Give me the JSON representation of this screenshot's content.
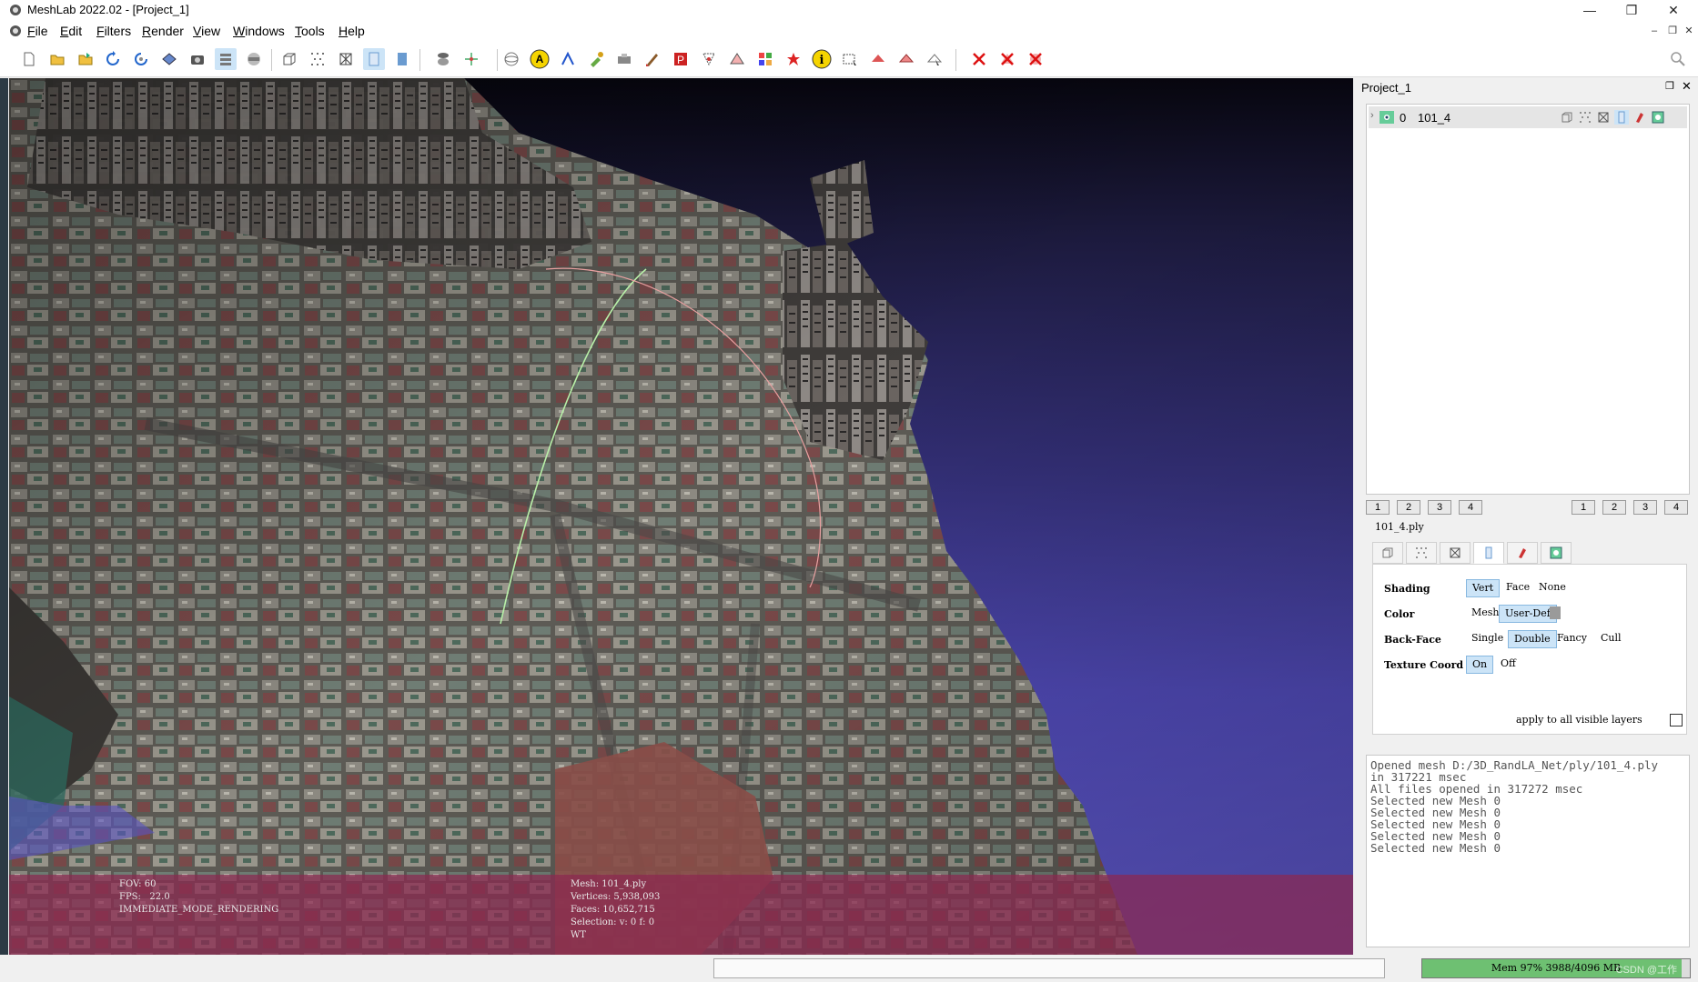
{
  "window": {
    "title": "MeshLab 2022.02 - [Project_1]",
    "minimize": "—",
    "restore": "❐",
    "close": "✕"
  },
  "menu": [
    {
      "label": "File",
      "u": "F",
      "rest": "ile"
    },
    {
      "label": "Edit",
      "u": "E",
      "rest": "dit"
    },
    {
      "label": "Filters",
      "u": "F",
      "rest": "ilters"
    },
    {
      "label": "Render",
      "u": "R",
      "rest": "ender"
    },
    {
      "label": "View",
      "u": "V",
      "rest": "iew"
    },
    {
      "label": "Windows",
      "u": "W",
      "rest": "indows"
    },
    {
      "label": "Tools",
      "u": "T",
      "rest": "ools"
    },
    {
      "label": "Help",
      "u": "H",
      "rest": "elp"
    }
  ],
  "mdi": {
    "minimize": "–",
    "restore": "❐",
    "close": "✕"
  },
  "viewport": {
    "info_left": "FOV: 60\nFPS:   22.0\nIMMEDIATE_MODE_RENDERING",
    "info_right": "Mesh: 101_4.ply\nVertices: 5,938,093\nFaces: 10,652,715\nSelection: v: 0 f: 0\nWT"
  },
  "layers": {
    "header": "Project_1",
    "rows": [
      {
        "index": "0",
        "name": "101_4"
      }
    ],
    "left_buttons": [
      "1",
      "2",
      "3",
      "4"
    ],
    "right_buttons": [
      "1",
      "2",
      "3",
      "4"
    ]
  },
  "render_panel": {
    "mesh_name": "101_4.ply",
    "shading": {
      "label": "Shading",
      "options": [
        "Vert",
        "Face",
        "None"
      ],
      "selected": "Vert"
    },
    "color": {
      "label": "Color",
      "options": [
        "Mesh",
        "User-Def"
      ],
      "selected": "User-Def",
      "swatch": "#9a9a9a"
    },
    "backface": {
      "label": "Back-Face",
      "options": [
        "Single",
        "Double",
        "Fancy",
        "Cull"
      ],
      "selected": "Double"
    },
    "texcoord": {
      "label": "Texture Coord",
      "options": [
        "On",
        "Off"
      ],
      "selected": "On"
    },
    "apply_label": "apply to all visible layers"
  },
  "log": [
    "Opened mesh D:/3D_RandLA_Net/ply/101_4.ply",
    "in 317221 msec",
    "All files opened in 317272 msec",
    "Selected new Mesh 0",
    "Selected new Mesh 0",
    "Selected new Mesh 0",
    "Selected new Mesh 0",
    "Selected new Mesh 0"
  ],
  "status": {
    "mem_text": "Mem 97% 3988/4096 MB",
    "mem_fraction": 0.97,
    "watermark": "CSDN @工作"
  },
  "colors": {
    "accent_select": "#cce4f7",
    "mem_bar": "#6ec072",
    "info_overlay": "#8c2850"
  }
}
